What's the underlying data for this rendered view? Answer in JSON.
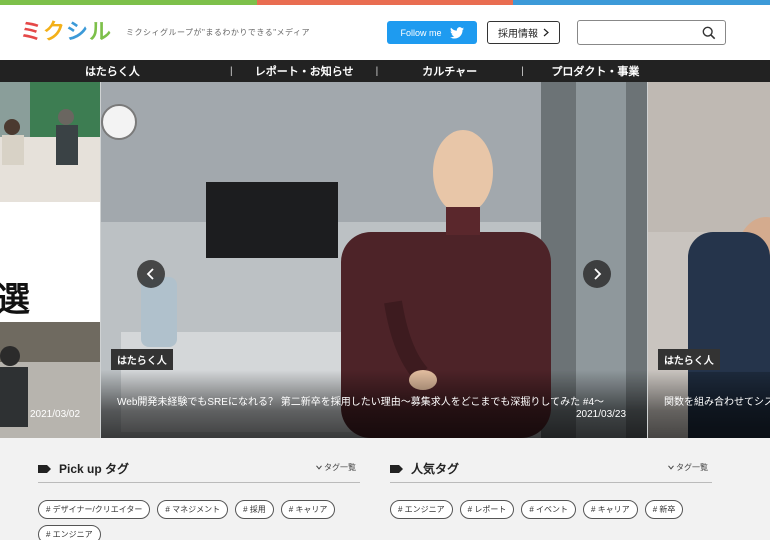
{
  "colors": {
    "stripe": [
      "#7dc04a",
      "#e96d51",
      "#3c9ad8"
    ],
    "twitter": "#1e9bf0",
    "nav_bg": "#222222",
    "logo": [
      "#e54848",
      "#f3b019",
      "#3c9ad8",
      "#7dc04a",
      "#e96d51"
    ]
  },
  "header": {
    "logo_chars": [
      "ミ",
      "ク",
      "シ",
      "ル"
    ],
    "tagline": "ミクシィグループが\"まるわかりできる\"メディア",
    "follow_label": "Follow me",
    "recruit_label": "採用情報",
    "search_placeholder": ""
  },
  "nav": {
    "items": [
      "はたらく人",
      "レポート・お知らせ",
      "カルチャー",
      "プロダクト・事業"
    ],
    "separator": "|"
  },
  "carousel": {
    "left": {
      "big_char": "選",
      "date": "2021/03/02"
    },
    "center": {
      "category": "はたらく人",
      "title": "Web開発未経験でもSREになれる？ 第二新卒を採用したい理由〜募集求人をどこまでも深掘りしてみた #4〜",
      "date": "2021/03/23"
    },
    "right": {
      "category": "はたらく人",
      "title": "関数を組み合わせてシス"
    }
  },
  "pickup": {
    "heading": "Pick up タグ",
    "all_link": "タグ一覧",
    "tags": [
      "# デザイナー/クリエイター",
      "# マネジメント",
      "# 採用",
      "# キャリア",
      "# エンジニア"
    ]
  },
  "popular": {
    "heading": "人気タグ",
    "all_link": "タグ一覧",
    "tags": [
      "# エンジニア",
      "# レポート",
      "# イベント",
      "# キャリア",
      "# 新卒"
    ]
  }
}
